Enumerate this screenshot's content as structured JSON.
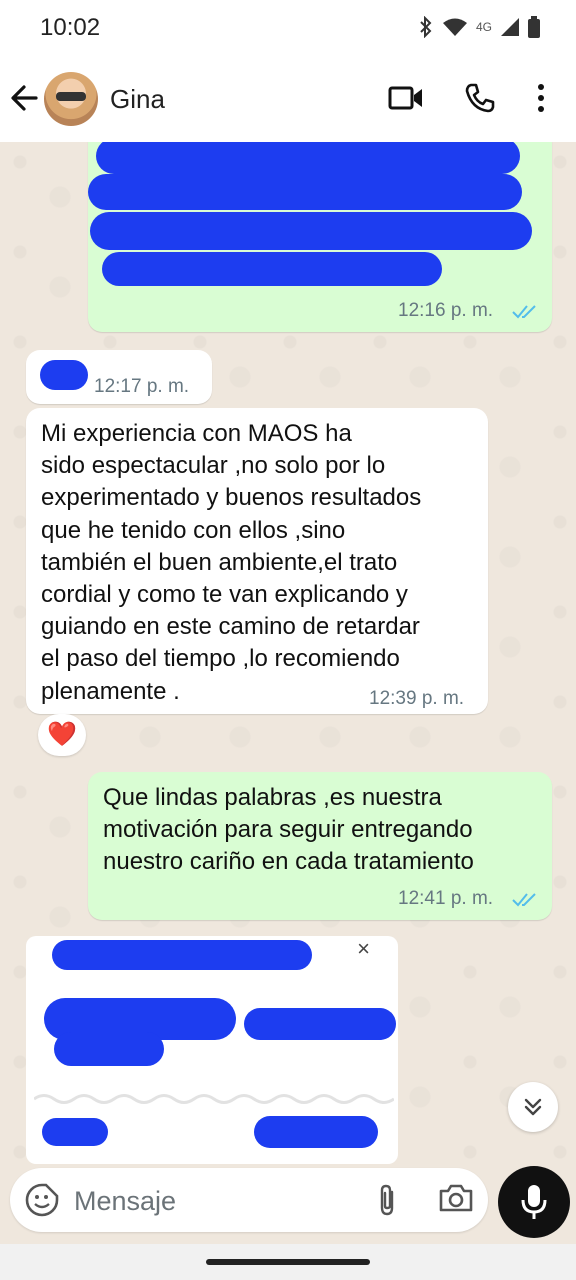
{
  "status_bar": {
    "time": "10:02",
    "network": "4G"
  },
  "header": {
    "contact_name": "Gina"
  },
  "messages": [
    {
      "direction": "outgoing",
      "time": "12:16 p. m."
    },
    {
      "direction": "incoming",
      "time": "12:17 p. m."
    },
    {
      "direction": "incoming",
      "text": "Mi experiencia con MAOS ha\nsido espectacular ,no solo por lo\nexperimentado y buenos resultados\nque he tenido con ellos ,sino\ntambién el buen ambiente,el trato\ncordial y como te van explicando y\nguiando en este camino de retardar\nel paso del tiempo ,lo recomiendo\nplenamente .",
      "time": "12:39 p. m.",
      "reaction": "❤️"
    },
    {
      "direction": "outgoing",
      "text": "Que lindas palabras ,es nuestra\nmotivación para seguir entregando\nnuestro cariño en cada tratamiento",
      "time": "12:41 p. m."
    }
  ],
  "preview": {
    "close_label": "×"
  },
  "composer": {
    "placeholder": "Mensaje"
  },
  "colors": {
    "accent": "#53bdeb",
    "outgoing_bubble": "#d9fdd3",
    "incoming_bubble": "#ffffff",
    "redaction": "#1d3df0",
    "chat_background": "#efe7dd"
  },
  "icons": [
    "back-arrow-icon",
    "video-call-icon",
    "phone-icon",
    "more-vert-icon",
    "emoji-icon",
    "attach-icon",
    "camera-icon",
    "mic-icon",
    "double-check-icon",
    "chevron-double-down-icon"
  ]
}
